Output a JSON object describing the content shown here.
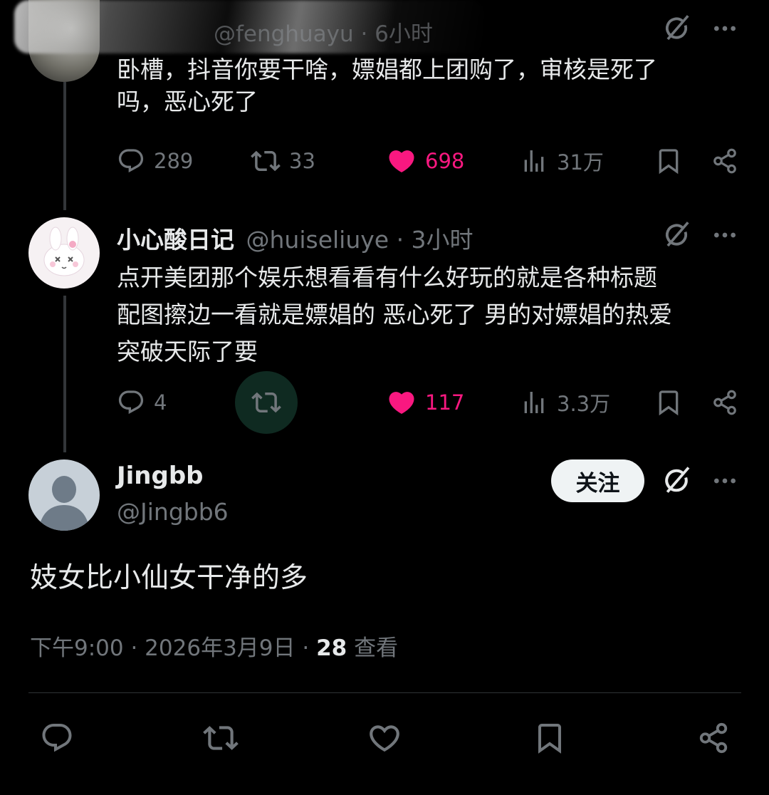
{
  "tweets": [
    {
      "name": "",
      "handle": "@fenghuayu · 6小时",
      "text_line1": "卧槽，抖音你要干啥，嫖娼都上团购了，审核是死了",
      "text_line2": "吗，恶心死了",
      "replies": "289",
      "reposts": "33",
      "likes": "698",
      "views": "31万"
    },
    {
      "name": "小心酸日记",
      "handle": "@huiseliuye · 3小时",
      "text_line1": "点开美团那个娱乐想看看有什么好玩的就是各种标题",
      "text_line2": "配图擦边一看就是嫖娼的 恶心死了 男的对嫖娼的热爱",
      "text_line3": "突破天际了要",
      "replies": "4",
      "reposts": "",
      "likes": "117",
      "views": "3.3万"
    }
  ],
  "main_tweet": {
    "name": "Jingbb",
    "handle": "@Jingbb6",
    "follow_label": "关注",
    "text": "妓女比小仙女干净的多",
    "meta_time": "下午9:00 · 2026年3月9日 · ",
    "views_count": "28",
    "views_label": " 查看"
  },
  "colors": {
    "background": "#000000",
    "text": "#e7e9ea",
    "muted": "#71767b",
    "like": "#f91880",
    "repost_highlight": "#00ba7c"
  },
  "icons": [
    "reply-icon",
    "repost-icon",
    "like-icon",
    "views-icon",
    "bookmark-icon",
    "share-icon",
    "grok-icon",
    "more-icon"
  ]
}
